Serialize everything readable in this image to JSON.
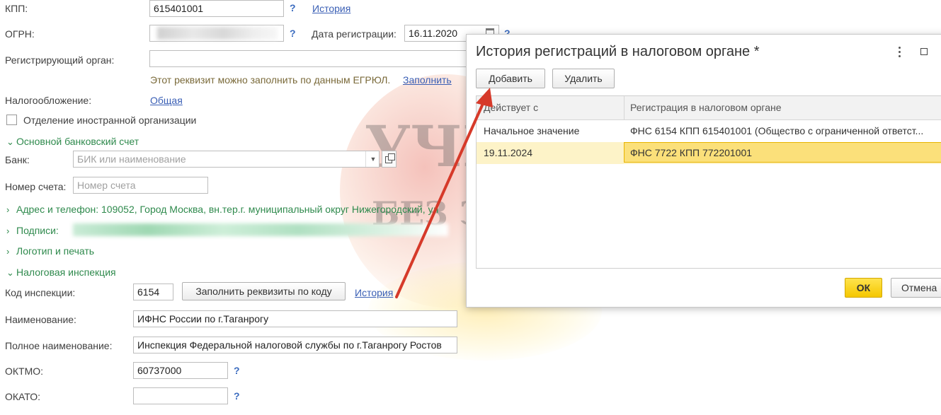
{
  "form": {
    "kpp_label": "КПП:",
    "kpp_value": "615401001",
    "kpp_help": "?",
    "kpp_history": "История",
    "ogrn_label": "ОГРН:",
    "ogrn_help": "?",
    "reg_date_label": "Дата регистрации:",
    "reg_date_value": "16.11.2020",
    "reg_date_help": "?",
    "reg_authority_label": "Регистрирующий орган:",
    "egrul_hint": "Этот реквизит можно заполнить по данным ЕГРЮЛ.",
    "egrul_fill_link": "Заполнить",
    "taxation_label": "Налогообложение:",
    "taxation_value": "Общая",
    "foreign_branch_label": "Отделение иностранной организации",
    "bank_section": "Основной банковский счет",
    "bank_label": "Банк:",
    "bank_placeholder": "БИК или наименование",
    "account_label": "Номер счета:",
    "account_placeholder": "Номер счета",
    "address_section": "Адрес и телефон: 109052, Город Москва, вн.тер.г. муниципальный округ Нижегородский, ул",
    "signatures_section": "Подписи: ",
    "logo_section": "Логотип и печать",
    "tax_section": "Налоговая инспекция",
    "inspection_code_label": "Код инспекции:",
    "inspection_code_value": "6154",
    "fill_by_code_button": "Заполнить реквизиты по коду",
    "inspection_history": "История",
    "name_label": "Наименование:",
    "name_value": "ИФНС России по г.Таганрогу",
    "full_name_label": "Полное наименование:",
    "full_name_value": "Инспекция Федеральной налоговой службы по г.Таганрогу Ростов",
    "oktmo_label": "ОКТМО:",
    "oktmo_value": "60737000",
    "oktmo_help": "?",
    "okato_label": "ОКАТО:",
    "okato_value": "",
    "okato_help": "?"
  },
  "watermark": {
    "line1": "УЧЁТ",
    "line2": "БЕЗ ЗАБОТ"
  },
  "dialog": {
    "title": "История регистраций в налоговом органе *",
    "add_button": "Добавить",
    "delete_button": "Удалить",
    "columns": [
      "Действует с",
      "Регистрация в налоговом органе"
    ],
    "rows": [
      {
        "date": "Начальное значение",
        "registration": "ФНС 6154 КПП 615401001 (Общество с ограниченной ответст..."
      },
      {
        "date": "19.11.2024",
        "registration": "ФНС 7722 КПП 772201001"
      }
    ],
    "selected_row": 1,
    "ok_button": "ОК",
    "cancel_button": "Отмена"
  },
  "colors": {
    "accent_yellow": "#f5c700",
    "section_green": "#2f8a4d",
    "link_blue": "#3a5fb5",
    "arrow_red": "#d63a2a"
  }
}
